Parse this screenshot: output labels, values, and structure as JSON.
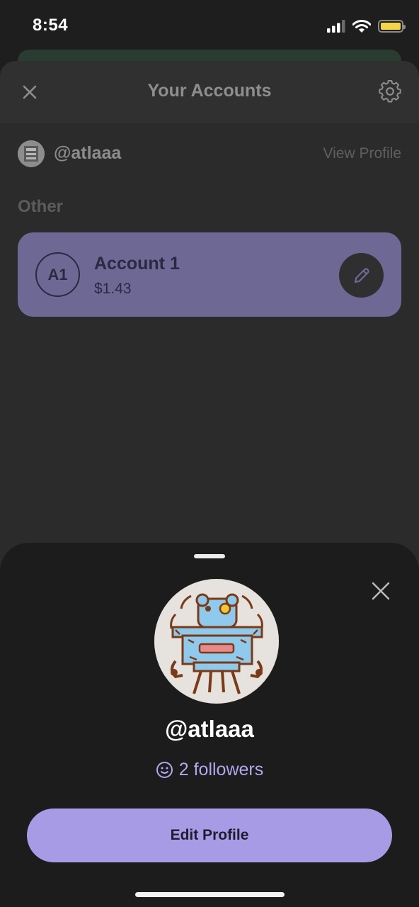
{
  "status_bar": {
    "time": "8:54",
    "signal_icon": "cellular-signal-icon",
    "wifi_icon": "wifi-icon",
    "battery_icon": "battery-icon",
    "battery_color": "#f5d547"
  },
  "accounts_screen": {
    "title": "Your Accounts",
    "close_icon": "close-icon",
    "settings_icon": "gear-icon",
    "current_profile": {
      "handle": "@atlaaa",
      "view_profile_label": "View Profile"
    },
    "section_label": "Other",
    "accounts": [
      {
        "badge": "A1",
        "name": "Account 1",
        "balance": "$1.43",
        "edit_icon": "pencil-icon"
      }
    ],
    "card_color": "#6e6895"
  },
  "profile_sheet": {
    "close_icon": "close-icon",
    "handle": "@atlaaa",
    "followers_icon": "smiley-icon",
    "followers_text": "2 followers",
    "edit_profile_label": "Edit Profile",
    "accent_color": "#a89be6"
  }
}
